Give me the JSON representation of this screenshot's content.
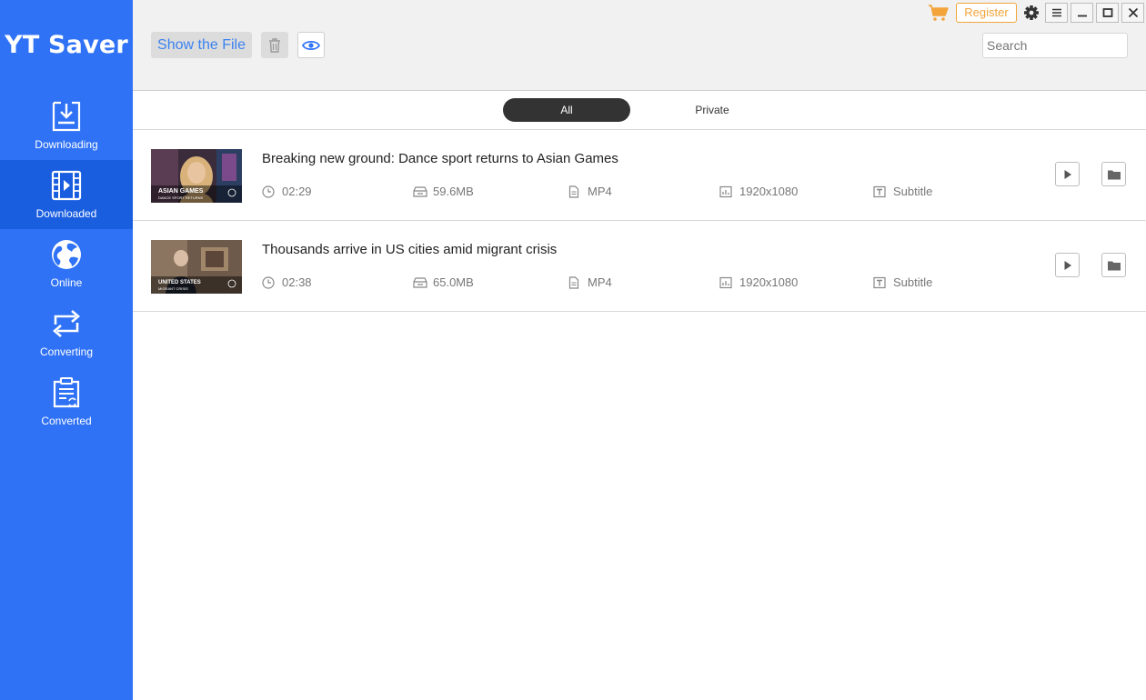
{
  "app": {
    "title": "YT Saver"
  },
  "sidebar": {
    "items": [
      {
        "label": "Downloading",
        "icon": "download-tray-icon",
        "active": false
      },
      {
        "label": "Downloaded",
        "icon": "film-icon",
        "active": true
      },
      {
        "label": "Online",
        "icon": "globe-icon",
        "active": false
      },
      {
        "label": "Converting",
        "icon": "convert-arrows-icon",
        "active": false
      },
      {
        "label": "Converted",
        "icon": "converted-document-icon",
        "active": false
      }
    ]
  },
  "toolbar": {
    "show_file_label": "Show the File",
    "trash_icon": "trash-icon",
    "eye_icon": "eye-icon",
    "register_label": "Register",
    "cart_icon": "cart-icon",
    "settings_icon": "gear-icon",
    "window_buttons": [
      "menu-icon",
      "minimize-icon",
      "maximize-icon",
      "close-icon"
    ]
  },
  "search": {
    "placeholder": "Search"
  },
  "filters": {
    "tabs": [
      {
        "label": "All",
        "selected": true
      },
      {
        "label": "Private",
        "selected": false
      }
    ]
  },
  "videos": [
    {
      "title": "Breaking new ground: Dance sport returns to Asian Games",
      "duration": "02:29",
      "size": "59.6MB",
      "format": "MP4",
      "resolution": "1920x1080",
      "subtitle": "Subtitle",
      "thumb_caption_1": "ASIAN GAMES",
      "thumb_caption_2": "DANCE SPORT RETURNS"
    },
    {
      "title": "Thousands arrive in US cities amid migrant crisis",
      "duration": "02:38",
      "size": "65.0MB",
      "format": "MP4",
      "resolution": "1920x1080",
      "subtitle": "Subtitle",
      "thumb_caption_1": "UNITED STATES",
      "thumb_caption_2": "MIGRANT CRISIS"
    }
  ],
  "colors": {
    "sidebar_bg": "#2f72f5",
    "sidebar_active": "#1a5ee0",
    "accent_text": "#3b82f0",
    "register_orange": "#f2a43a"
  }
}
